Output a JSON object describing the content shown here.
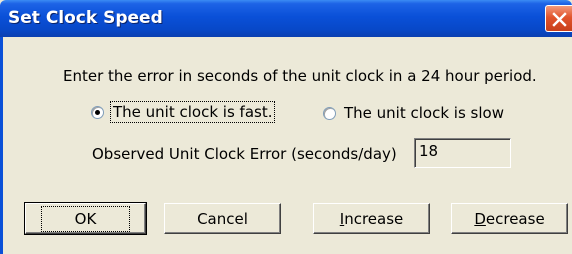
{
  "window": {
    "title": "Set Clock Speed"
  },
  "dialog": {
    "prompt": "Enter the error in seconds of the unit clock in a 24 hour period.",
    "radio_fast_label": "The unit clock is fast.",
    "radio_slow_label": "The unit clock is slow",
    "radio_selected": "fast",
    "error_label": "Observed Unit Clock Error  (seconds/day)",
    "error_value": "18"
  },
  "buttons": {
    "ok": "OK",
    "cancel": "Cancel",
    "increase_first": "I",
    "increase_rest": "ncrease",
    "decrease_first": "D",
    "decrease_rest": "ecrease"
  },
  "icons": {
    "close": "close-icon"
  },
  "colors": {
    "titlebar": "#0a50d8",
    "close": "#e1542c",
    "dialog_bg": "#ece9d8"
  }
}
